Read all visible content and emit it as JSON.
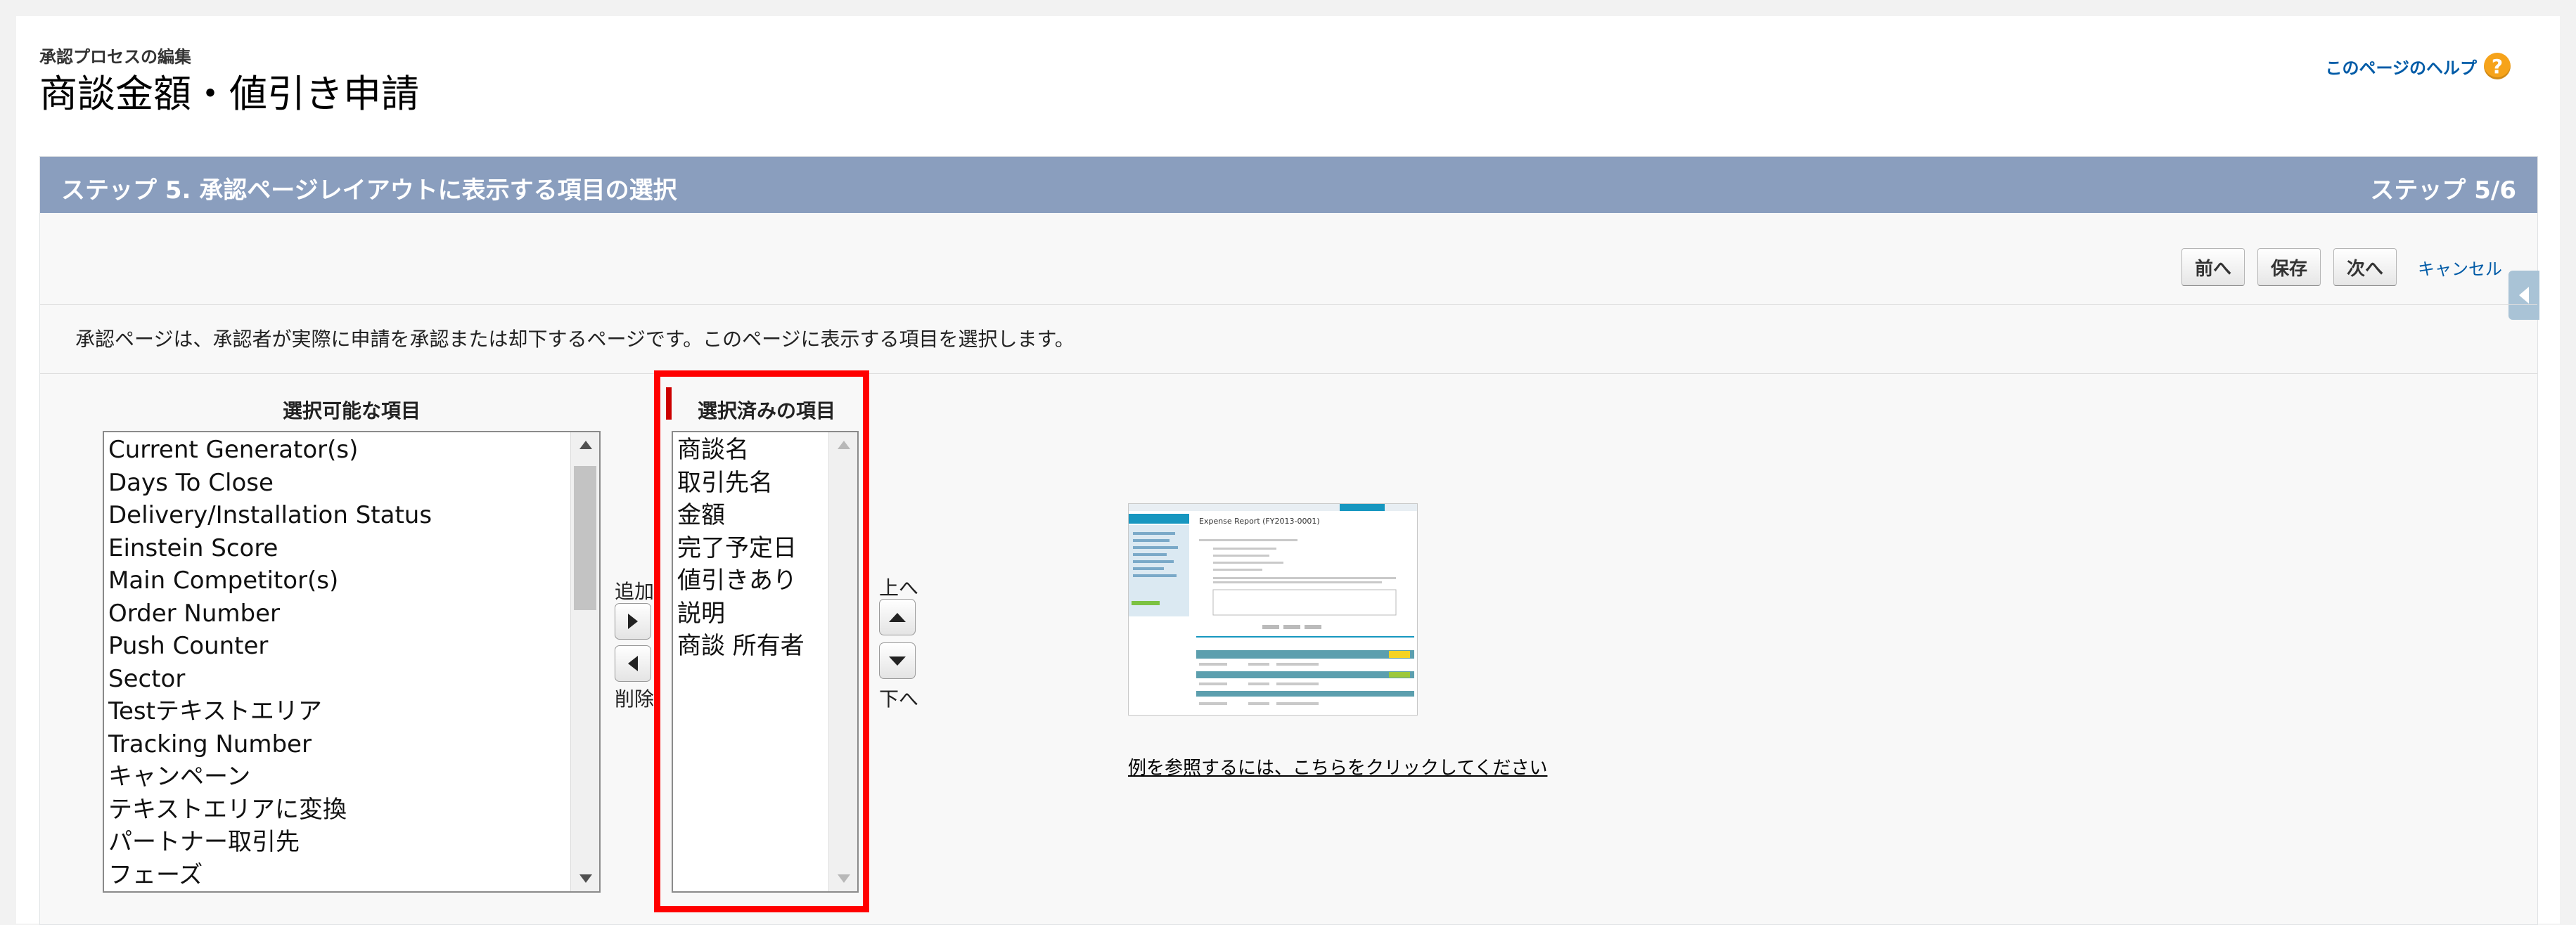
{
  "header": {
    "subtitle": "承認プロセスの編集",
    "title": "商談金額・値引き申請",
    "help_link": "このページのヘルプ",
    "help_icon": "?"
  },
  "step": {
    "title": "ステップ 5. 承認ページレイアウトに表示する項目の選択",
    "counter": "ステップ 5/6",
    "buttons": {
      "prev": "前へ",
      "save": "保存",
      "next": "次へ",
      "cancel": "キャンセル"
    },
    "description": "承認ページは、承認者が実際に申請を承認または却下するページです。このページに表示する項目を選択します。"
  },
  "available": {
    "label": "選択可能な項目",
    "items": [
      "Current Generator(s)",
      "Days To Close",
      "Delivery/Installation Status",
      "Einstein Score",
      "Main Competitor(s)",
      "Order Number",
      "Push Counter",
      "Sector",
      "Testテキストエリア",
      "Tracking Number",
      "キャンペーン",
      "テキストエリアに変換",
      "パートナー取引先",
      "フェーズ"
    ]
  },
  "movers": {
    "add_label": "追加",
    "remove_label": "削除",
    "up_label": "上へ",
    "down_label": "下へ"
  },
  "selected": {
    "label": "選択済みの項目",
    "items": [
      "商談名",
      "取引先名",
      "金額",
      "完了予定日",
      "値引きあり",
      "説明",
      "商談 所有者"
    ]
  },
  "preview": {
    "link": "例を参照するには、こちらをクリックしてください",
    "thumb_title": "Expense Report (FY2013-0001)"
  },
  "colors": {
    "header_bar": "#8a9ebe",
    "highlight": "#ff0000",
    "link": "#015ba7",
    "help_icon": "#f6a31a"
  }
}
